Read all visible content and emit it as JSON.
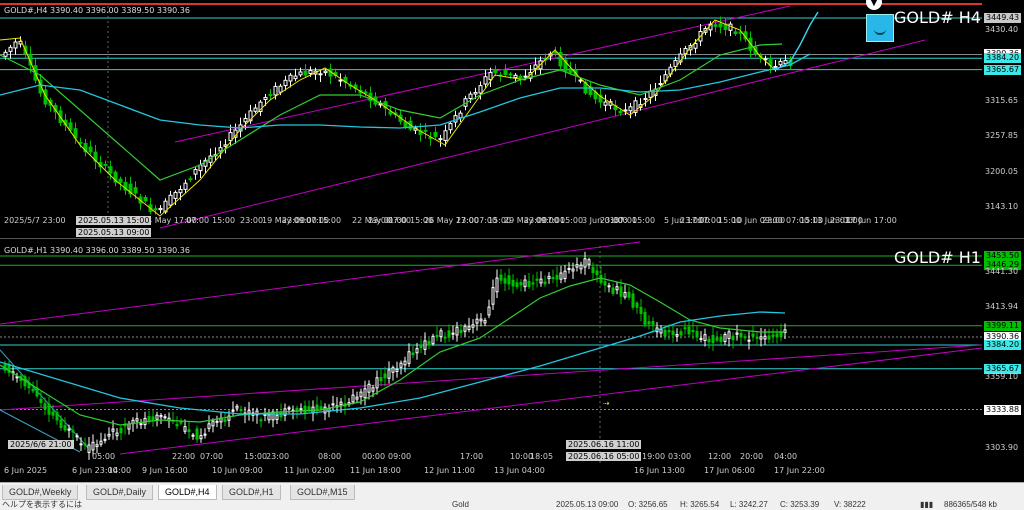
{
  "h4": {
    "header": "GOLD#,H4  3390.40 3396.00 3389.50 3390.36",
    "big_title": "GOLD# H4",
    "price_levels": [
      {
        "label": "3449.43",
        "value": 3449.43,
        "box": "#c8c8c8"
      },
      {
        "label": "3430.40",
        "value": 3430.4,
        "box": ""
      },
      {
        "label": "3390.36",
        "value": 3390.36,
        "box": "#ffffff"
      },
      {
        "label": "3384.20",
        "value": 3384.2,
        "box": "#3ee8e8"
      },
      {
        "label": "3365.67",
        "value": 3365.67,
        "box": "#3ee8e8"
      },
      {
        "label": "3315.65",
        "value": 3315.65,
        "box": ""
      },
      {
        "label": "3257.85",
        "value": 3257.85,
        "box": ""
      },
      {
        "label": "3200.05",
        "value": 3200.05,
        "box": ""
      },
      {
        "label": "3143.10",
        "value": 3143.1,
        "box": ""
      }
    ],
    "x_labels": [
      "2025/5/7 23:00",
      "2025.05.13 09:00",
      "14 May 17:00",
      "07:00",
      "15:00",
      "23:00",
      "19 May 09:00",
      "23:00",
      "07:00",
      "15:00",
      "22 May 01:00",
      "23:00",
      "07:00",
      "15:00",
      "26 May 17:00",
      "23:00",
      "07:00",
      "15:00",
      "29 May 09:00",
      "23:00",
      "07:00",
      "15:00",
      "3 Jun 01:00",
      "23:00",
      "07:00",
      "15:00",
      "5 Jun 17:00",
      "23:00",
      "07:00",
      "15:00",
      "10 Jun 09:00",
      "23:00",
      "07:00",
      "15:00",
      "13 Jun 01:00",
      "23:00",
      "17 Jun 17:00"
    ],
    "highlight_label": "2025.05.13 15:00"
  },
  "h1": {
    "header": "GOLD#,H1  3390.40 3396.00 3389.50 3390.36",
    "big_title": "GOLD# H1",
    "price_levels": [
      {
        "label": "3453.50",
        "value": 3453.5,
        "box": "#00c000"
      },
      {
        "label": "3446.29",
        "value": 3446.29,
        "box": "#00c000"
      },
      {
        "label": "3441.30",
        "value": 3441.3,
        "box": ""
      },
      {
        "label": "3413.94",
        "value": 3413.94,
        "box": ""
      },
      {
        "label": "3399.11",
        "value": 3399.11,
        "box": "#00c000"
      },
      {
        "label": "3390.36",
        "value": 3390.36,
        "box": "#ffffff"
      },
      {
        "label": "3384.20",
        "value": 3384.2,
        "box": "#3ee8e8"
      },
      {
        "label": "3365.67",
        "value": 3365.67,
        "box": "#3ee8e8"
      },
      {
        "label": "3359.10",
        "value": 3359.1,
        "box": ""
      },
      {
        "label": "3333.88",
        "value": 3333.88,
        "box": "#ffffff"
      },
      {
        "label": "3303.90",
        "value": 3303.9,
        "box": ""
      }
    ],
    "x_labels": [
      "6 Jun 2025",
      "2025/6/6 21:00",
      "6 Jun 23:00",
      "05:00",
      "14:00",
      "9 Jun 16:00",
      "22:00",
      "07:00",
      "10 Jun 09:00",
      "15:00",
      "23:00",
      "11 Jun 02:00",
      "08:00",
      "11 Jun 18:00",
      "00:00",
      "09:00",
      "12 Jun 11:00",
      "17:00",
      "13 Jun 04:00",
      "10:00",
      "18:05",
      "2025.06.16 11:00",
      "2025.06.16 05:00",
      "16 Jun 13:00",
      "19:00",
      "03:00",
      "17 Jun 06:00",
      "12:00",
      "20:00",
      "04:00",
      "17 Jun 22:00"
    ]
  },
  "tabs": [
    "GOLD#,Weekly",
    "GOLD#,Daily",
    "GOLD#,H4",
    "GOLD#,H1",
    "GOLD#,M15"
  ],
  "active_tab": "GOLD#,H4",
  "status": {
    "left": "ヘルプを表示するには",
    "symbol": "Gold",
    "date": "2025.05.13 09:00",
    "o": "O: 3256.65",
    "h": "H: 3265.54",
    "l": "L: 3242.27",
    "c": "C: 3253.39",
    "v": "V: 38222",
    "traffic": "886365/548 kb"
  },
  "colors": {
    "bull": "#ffffff",
    "bear": "#00c000",
    "ma_yellow": "#e8e800",
    "ma_green": "#33cc33",
    "ma_cyan": "#22c6e0",
    "channel": "#c000c0"
  }
}
